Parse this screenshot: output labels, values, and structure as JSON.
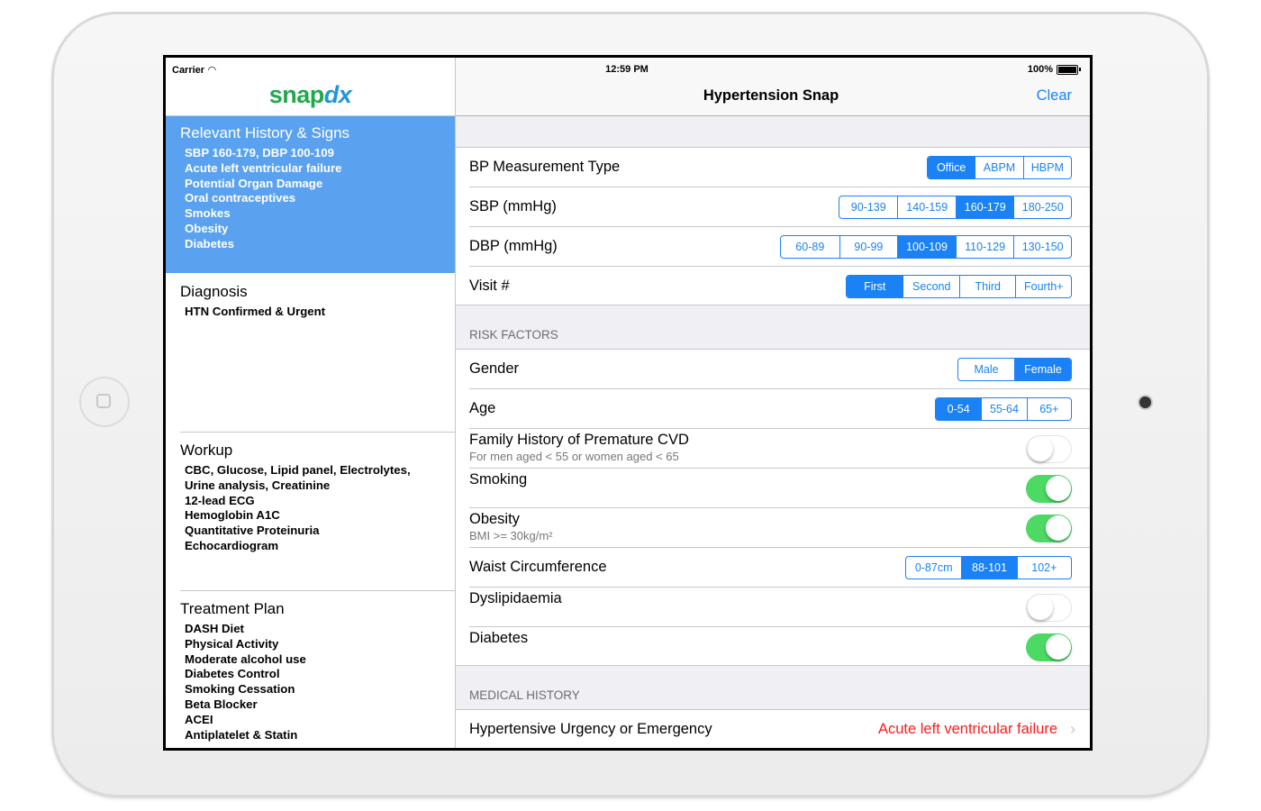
{
  "status": {
    "carrier": "Carrier",
    "time": "12:59 PM",
    "battery": "100%"
  },
  "master": {
    "logo": {
      "snap": "snap",
      "dx": "dx"
    },
    "sections": [
      {
        "title": "Relevant History & Signs",
        "items": [
          "SBP 160-179, DBP 100-109",
          "Acute left ventricular failure",
          "Potential Organ Damage",
          "Oral contraceptives",
          "Smokes",
          "Obesity",
          "Diabetes"
        ]
      },
      {
        "title": "Diagnosis",
        "items": [
          "HTN Confirmed & Urgent"
        ]
      },
      {
        "title": "Workup",
        "items": [
          "CBC, Glucose, Lipid panel, Electrolytes,",
          "Urine analysis, Creatinine",
          "12-lead ECG",
          "Hemoglobin A1C",
          "Quantitative Proteinuria",
          "Echocardiogram"
        ]
      },
      {
        "title": "Treatment Plan",
        "items": [
          "DASH Diet",
          "Physical Activity",
          "Moderate alcohol use",
          "Diabetes Control",
          "Smoking Cessation",
          "Beta Blocker",
          "ACEI",
          "Antiplatelet & Statin"
        ]
      }
    ]
  },
  "detail": {
    "title": "Hypertension Snap",
    "clear_label": "Clear",
    "measurement": {
      "rows": [
        {
          "label": "BP Measurement Type",
          "options": [
            "Office",
            "ABPM",
            "HBPM"
          ],
          "selected": 0
        },
        {
          "label": "SBP (mmHg)",
          "options": [
            "90-139",
            "140-159",
            "160-179",
            "180-250"
          ],
          "selected": 2
        },
        {
          "label": "DBP (mmHg)",
          "options": [
            "60-89",
            "90-99",
            "100-109",
            "110-129",
            "130-150"
          ],
          "selected": 2
        },
        {
          "label": "Visit #",
          "options": [
            "First",
            "Second",
            "Third",
            "Fourth+"
          ],
          "selected": 0
        }
      ]
    },
    "risk_factors": {
      "header": "RISK FACTORS",
      "gender": {
        "label": "Gender",
        "options": [
          "Male",
          "Female"
        ],
        "selected": 1
      },
      "age": {
        "label": "Age",
        "options": [
          "0-54",
          "55-64",
          "65+"
        ],
        "selected": 0
      },
      "family_history": {
        "label": "Family History of Premature CVD",
        "sublabel": "For men aged < 55 or women aged < 65",
        "on": false
      },
      "smoking": {
        "label": "Smoking",
        "on": true
      },
      "obesity": {
        "label": "Obesity",
        "sublabel": "BMI >= 30kg/m²",
        "on": true
      },
      "waist": {
        "label": "Waist Circumference",
        "options": [
          "0-87cm",
          "88-101",
          "102+"
        ],
        "selected": 1
      },
      "dyslipidaemia": {
        "label": "Dyslipidaemia",
        "on": false
      },
      "diabetes": {
        "label": "Diabetes",
        "on": true
      }
    },
    "medical_history": {
      "header": "MEDICAL HISTORY",
      "urgency": {
        "label": "Hypertensive Urgency or Emergency",
        "value": "Acute left ventricular failure"
      }
    }
  },
  "colors": {
    "accent": "#1a82f5",
    "selected_section": "#5aa2f0",
    "toggle_on": "#4cd964",
    "alert": "#ff1a1a",
    "logo_green": "#22a84a",
    "logo_blue": "#2196d6"
  }
}
